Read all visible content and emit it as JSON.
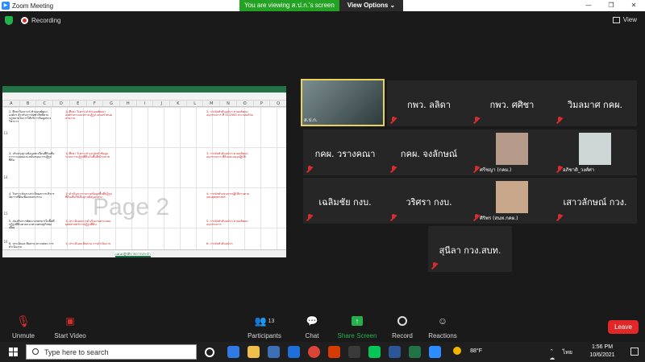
{
  "window": {
    "title": "Zoom Meeting",
    "controls": [
      "—",
      "❐",
      "✕"
    ]
  },
  "banner": {
    "viewing_text": "You are viewing ส.ป.ก.'s screen",
    "options_label": "View Options ⌄"
  },
  "status": {
    "recording_label": "Recording",
    "view_label": "View"
  },
  "shared_screen": {
    "watermark": "Page 2",
    "column_headers": [
      "A",
      "B",
      "C",
      "D",
      "E",
      "F",
      "G",
      "H",
      "I",
      "J",
      "K",
      "L",
      "M",
      "N",
      "O",
      "P",
      "Q"
    ],
    "row_numbers": [
      "13",
      "14",
      "15",
      "16"
    ],
    "rows": [
      {
        "left_text": "2. ศึกษาวิเคราะห์ ทำแผนพัฒนาองค์กร สำหรับการจัดทำสิทธิ์ตามกฎหมายในการให้บริการข้อมูลทางวิชาการ",
        "mid_text": "1) ศึกษา วิเคราะห์ ทำแผนพัฒนาองค์กรตามแนวทางปฏิรูป เสนอกำหนดสายงาน",
        "right_text": "2. การจัดทำต้นฉบับฯ ตามมติคณะอนุกรรมการ ที่ 31/2560 ประกอบด้วย"
      },
      {
        "left_text": "3. ปรับปรุงฐานข้อมูลทะเบียนที่ดินเพื่อการวางแผนและสนับสนุนการปฏิรูปที่ดิน",
        "mid_text": "1) ศึกษา วิเคราะห์ และจัดทำข้อมูลระบบการปฏิรูปที่ดินในพื้นที่เป้าหมาย",
        "right_text": "3. การจัดทำต้นฉบับฯ ตามมติคณะอนุกรรมการ ที่ดินและแผนปฏิบัติ"
      },
      {
        "left_text": "4. วิเคราะห์และประเมินผลการบริหารจัดการที่ดินเพื่อเกษตรกรรม",
        "mid_text": "1) ดำเนินการรวบรวมข้อมูลพื้นที่ปฏิรูปที่ดินเพื่อใช้เป็นฐานข้อมูลกลาง",
        "right_text": "4. การจัดทำแผนการปฏิบัติงานตามแผนยุทธศาสตร์"
      },
      {
        "left_text": "5. ส่งเสริมการพัฒนาเกษตรกรในพื้นที่ปฏิรูปที่ดินตามแนวทางเศรษฐกิจพอเพียง",
        "mid_text": "1) ประเมินผลการดำเนินงานตามแผนยุทธศาสตร์การปฏิรูปที่ดิน",
        "right_text": "5. การจัดทำต้นฉบับฯ ตามมติคณะอนุกรรมการ"
      },
      {
        "left_text": "6. ประเมินผล ติดตาม ตรวจสอบ การดำเนินงาน",
        "mid_text": "1) ประเมินผล ติดตาม การดำเนินงาน",
        "right_text": "6. การจัดทำต้นฉบับฯ"
      }
    ],
    "sheet_tab": "แผนปฏิบัติราชการประจำปี"
  },
  "participants_grid": [
    {
      "name": "ส.ป.ก.",
      "kind": "video"
    },
    {
      "name": "กพว. ลลิดา",
      "kind": "name"
    },
    {
      "name": "กพว. ศศิชา",
      "kind": "name"
    },
    {
      "name": "วิมลมาศ กคผ.",
      "kind": "name"
    },
    {
      "name": "กคผ. วรางคณา",
      "kind": "name"
    },
    {
      "name": "กคผ. จงลักษณ์",
      "kind": "name"
    },
    {
      "name": "ศรีชญา (กคผ.)",
      "kind": "photo"
    },
    {
      "name": "อภิชาติ_วงศ์ศา",
      "kind": "photo"
    },
    {
      "name": "เฉลิมชัย กงบ.",
      "kind": "name"
    },
    {
      "name": "วริศรา กงบ.",
      "kind": "name"
    },
    {
      "name": "ศิริพร (สนท.กคผ.)",
      "kind": "photo"
    },
    {
      "name": "เสาวลักษณ์ กวง.",
      "kind": "name"
    },
    {
      "name": "สุนีลา กวง.สบท.",
      "kind": "name"
    }
  ],
  "toolbar": {
    "unmute_label": "Unmute",
    "start_video_label": "Start Video",
    "participants_label": "Participants",
    "participants_count": "13",
    "chat_label": "Chat",
    "share_screen_label": "Share Screen",
    "record_label": "Record",
    "reactions_label": "Reactions",
    "leave_label": "Leave"
  },
  "taskbar": {
    "search_placeholder": "Type here to search",
    "weather": "88°F",
    "language": "ไทย",
    "time": "1:56 PM",
    "date": "10/6/2021"
  },
  "colors": {
    "zoom_blue": "#2d8cff",
    "viewing_green": "#23a223",
    "leave_red": "#e02828",
    "excel_green": "#217346"
  }
}
